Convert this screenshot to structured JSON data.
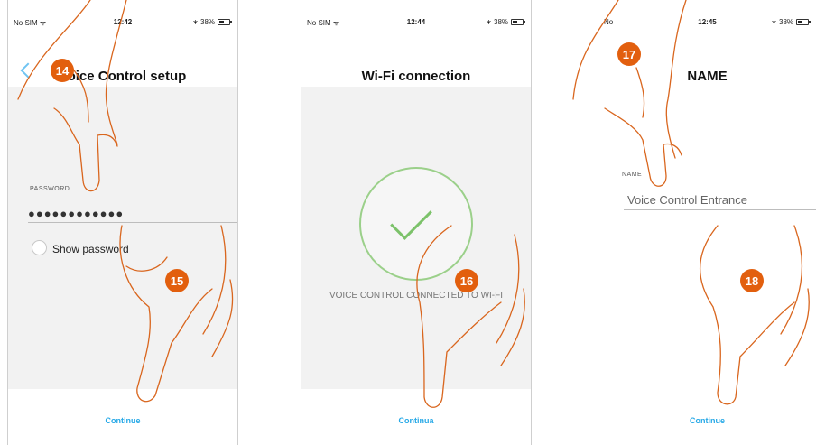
{
  "colors": {
    "accent": "#27a9e7",
    "badge": "#e25f0e",
    "hand_outline": "#d9661e",
    "success_ring": "#9bd08a",
    "success_check": "#7cc26a"
  },
  "screens": [
    {
      "status": {
        "carrier": "No SIM ᯤ",
        "time": "12:42",
        "battery": "∗ 38%"
      },
      "title": "Voice Control setup",
      "password_label": "PASSWORD",
      "password_value": "●●●●●●●●●●●●",
      "show_password_label": "Show password",
      "continue_label": "Continue",
      "badges": [
        "14",
        "15"
      ]
    },
    {
      "status": {
        "carrier": "No SIM ᯤ",
        "time": "12:44",
        "battery": "∗ 38%"
      },
      "title": "Wi-Fi connection",
      "status_message": "VOICE CONTROL CONNECTED TO WI-FI",
      "continue_label": "Continua",
      "badges": [
        "16"
      ]
    },
    {
      "status": {
        "carrier": "No",
        "time": "12:45",
        "battery": "∗ 38%"
      },
      "title": "NAME",
      "name_label": "NAME",
      "name_value": "Voice Control Entrance",
      "continue_label": "Continue",
      "badges": [
        "17",
        "18"
      ]
    }
  ]
}
